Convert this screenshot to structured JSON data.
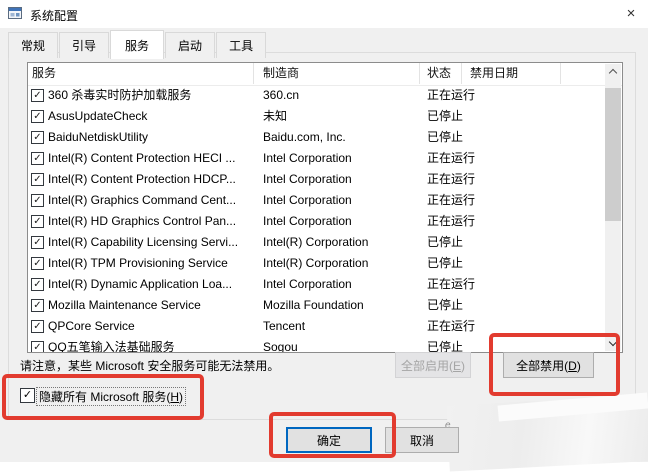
{
  "window": {
    "title": "系统配置"
  },
  "tabs": [
    {
      "label": "常规",
      "active": false
    },
    {
      "label": "引导",
      "active": false
    },
    {
      "label": "服务",
      "active": true
    },
    {
      "label": "启动",
      "active": false
    },
    {
      "label": "工具",
      "active": false
    }
  ],
  "services": {
    "columns": {
      "service": "服务",
      "manufacturer": "制造商",
      "status": "状态",
      "date_disabled": "禁用日期"
    },
    "rows": [
      {
        "checked": true,
        "name": "360 杀毒实时防护加载服务",
        "manufacturer": "360.cn",
        "status": "正在运行"
      },
      {
        "checked": true,
        "name": "AsusUpdateCheck",
        "manufacturer": "未知",
        "status": "已停止"
      },
      {
        "checked": true,
        "name": "BaiduNetdiskUtility",
        "manufacturer": "Baidu.com, Inc.",
        "status": "已停止"
      },
      {
        "checked": true,
        "name": "Intel(R) Content Protection HECI ...",
        "manufacturer": "Intel Corporation",
        "status": "正在运行"
      },
      {
        "checked": true,
        "name": "Intel(R) Content Protection HDCP...",
        "manufacturer": "Intel Corporation",
        "status": "正在运行"
      },
      {
        "checked": true,
        "name": "Intel(R) Graphics Command Cent...",
        "manufacturer": "Intel Corporation",
        "status": "正在运行"
      },
      {
        "checked": true,
        "name": "Intel(R) HD Graphics Control Pan...",
        "manufacturer": "Intel Corporation",
        "status": "正在运行"
      },
      {
        "checked": true,
        "name": "Intel(R) Capability Licensing Servi...",
        "manufacturer": "Intel(R) Corporation",
        "status": "已停止"
      },
      {
        "checked": true,
        "name": "Intel(R) TPM Provisioning Service",
        "manufacturer": "Intel(R) Corporation",
        "status": "已停止"
      },
      {
        "checked": true,
        "name": "Intel(R) Dynamic Application Loa...",
        "manufacturer": "Intel Corporation",
        "status": "正在运行"
      },
      {
        "checked": true,
        "name": "Mozilla Maintenance Service",
        "manufacturer": "Mozilla Foundation",
        "status": "已停止"
      },
      {
        "checked": true,
        "name": "QPCore Service",
        "manufacturer": "Tencent",
        "status": "正在运行"
      },
      {
        "checked": true,
        "name": "QQ五笔输入法基础服务",
        "manufacturer": "Sogou",
        "status": "已停止"
      }
    ]
  },
  "note": "请注意，某些 Microsoft 安全服务可能无法禁用。",
  "buttons": {
    "enable_all": {
      "pre": "全部启用(",
      "key": "E",
      "post": ")"
    },
    "disable_all": {
      "pre": "全部禁用(",
      "key": "D",
      "post": ")"
    },
    "ok": "确定",
    "cancel": "取消"
  },
  "hide_ms_checkbox": {
    "pre": "隐藏所有 Microsoft 服务(",
    "key": "H",
    "post": ")",
    "checked": true
  },
  "icons": {
    "check_glyph": "✓",
    "close_glyph": "×"
  },
  "colors": {
    "annotation_red": "#e23b2f",
    "focus_blue": "#0067c0",
    "dialog_bg": "#f0f0f0"
  }
}
